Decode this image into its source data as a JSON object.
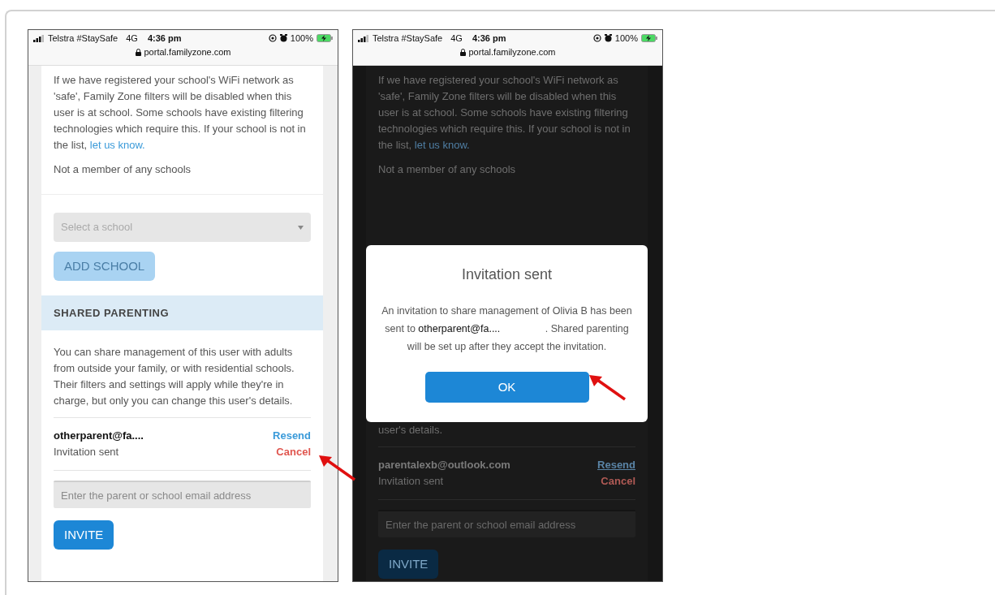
{
  "phones": [
    {
      "dimmed": false,
      "status_bar": {
        "carrier": "Telstra #StaySafe",
        "network": "4G",
        "time": "4:36 pm",
        "battery": "100%",
        "url": "portal.familyzone.com"
      },
      "sections": [
        {
          "kind": "paragraph",
          "text": "If we have registered your school's WiFi network as 'safe', Family Zone filters will be disabled when this user is at school. Some schools have existing filtering technologies which require this. If your school is not in the list, ",
          "link": "let us know."
        },
        {
          "kind": "note",
          "text": "Not a member of any schools"
        },
        {
          "kind": "select",
          "placeholder": "Select a school"
        },
        {
          "kind": "button",
          "label": "ADD SCHOOL",
          "disabled": true
        },
        {
          "kind": "header",
          "text": "SHARED PARENTING"
        },
        {
          "kind": "paragraph",
          "text": "You can share management of this user with adults from outside your family, or with residential schools. Their filters and settings will apply while they're in charge, but only you can change this user's details."
        },
        {
          "kind": "invitee",
          "email": "otherparent@fa....",
          "status": "Invitation sent",
          "actions": [
            {
              "kind": "resend",
              "label": "Resend"
            },
            {
              "kind": "cancel",
              "label": "Cancel"
            }
          ]
        },
        {
          "kind": "input",
          "placeholder": "Enter the parent or school email address"
        },
        {
          "kind": "button",
          "label": "INVITE",
          "disabled": false
        }
      ]
    },
    {
      "dimmed": true,
      "status_bar": {
        "carrier": "Telstra #StaySafe",
        "network": "4G",
        "time": "4:36 pm",
        "battery": "100%",
        "url": "portal.familyzone.com"
      },
      "sections": [
        {
          "kind": "paragraph",
          "text": "If we have registered your school's WiFi network as 'safe', Family Zone filters will be disabled when this user is at school. Some schools have existing filtering technologies which require this. If your school is not in the list, ",
          "link": "let us know."
        },
        {
          "kind": "note",
          "text": "Not a member of any schools"
        },
        {
          "kind": "dialog",
          "title": "Invitation sent",
          "message": "An invitation to share management of Olivia B has been sent to **otherparent@fa....** . Shared parenting will be set up after they accept the invitation.",
          "button": "OK"
        },
        {
          "kind": "tail",
          "text": "user's details."
        },
        {
          "kind": "invitee",
          "email": "parentalexb@outlook.com",
          "status": "Invitation sent",
          "actions": [
            {
              "kind": "resend",
              "label": "Resend"
            },
            {
              "kind": "cancel",
              "label": "Cancel"
            }
          ]
        },
        {
          "kind": "input",
          "placeholder": "Enter the parent or school email address"
        },
        {
          "kind": "button",
          "label": "INVITE",
          "disabled": false
        }
      ]
    }
  ]
}
